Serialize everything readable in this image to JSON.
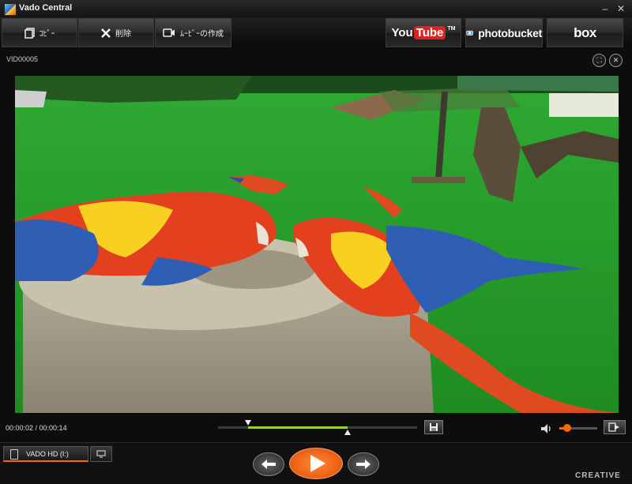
{
  "window": {
    "title": "Vado Central"
  },
  "toolbar": {
    "copy_label": "ｺﾋﾟｰ",
    "delete_label": "削除",
    "make_movie_label": "ﾑｰﾋﾞｰの作成",
    "youtube": {
      "you": "You",
      "tube": "Tube",
      "tm": "TM"
    },
    "photobucket": "photobucket",
    "box": "box"
  },
  "file": {
    "name": "VID00005"
  },
  "player": {
    "time": "00:00:02 / 00:00:14",
    "seek": {
      "start_fraction": 0.15,
      "end_fraction": 0.65,
      "position_fraction": 0.15
    },
    "volume_fraction": 0.2,
    "accent": "#ff6600",
    "progress_color": "#9fd02a"
  },
  "device": {
    "label": "VADO HD (I:)"
  },
  "brand": {
    "footer_logo": "CREATIVE"
  },
  "icons": [
    "app-icon",
    "copy-icon",
    "delete-icon",
    "camera-icon",
    "fullscreen-icon",
    "close-icon",
    "save-frame-icon",
    "speaker-icon",
    "export-icon",
    "device-icon",
    "monitor-icon",
    "previous-icon",
    "play-icon",
    "next-icon"
  ]
}
